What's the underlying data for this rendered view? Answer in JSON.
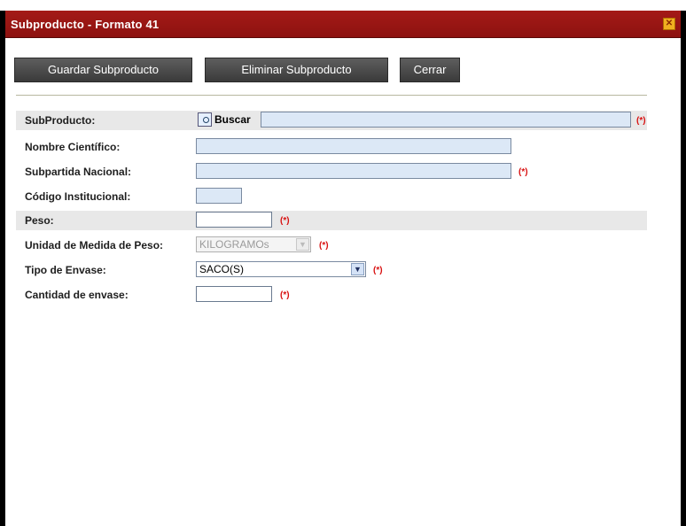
{
  "window": {
    "title": "Subproducto - Formato 41",
    "close_icon": "close-icon"
  },
  "toolbar": {
    "save_label": "Guardar Subproducto",
    "delete_label": "Eliminar Subproducto",
    "close_label": "Cerrar"
  },
  "form": {
    "required_mark": "(*)",
    "subproducto": {
      "label": "SubProducto:",
      "search_label": "Buscar",
      "value": ""
    },
    "nombre_cientifico": {
      "label": "Nombre Científico:",
      "value": ""
    },
    "subpartida_nacional": {
      "label": "Subpartida Nacional:",
      "value": ""
    },
    "codigo_institucional": {
      "label": "Código Institucional:",
      "value": ""
    },
    "peso": {
      "label": "Peso:",
      "value": ""
    },
    "unidad_medida_peso": {
      "label": "Unidad de Medida de Peso:",
      "selected": "KILOGRAMOs"
    },
    "tipo_envase": {
      "label": "Tipo de Envase:",
      "selected": "SACO(S)"
    },
    "cantidad_envase": {
      "label": "Cantidad de envase:",
      "value": ""
    }
  },
  "colors": {
    "titlebar": "#a41a17",
    "required": "#d81010",
    "field_fill": "#dce8f6"
  }
}
